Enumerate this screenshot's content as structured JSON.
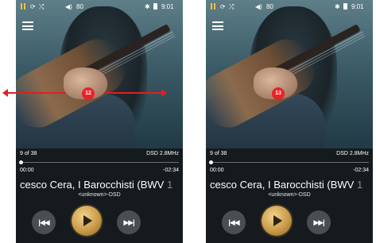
{
  "frames": [
    {
      "statusbar": {
        "volume": "80",
        "time": "9:01"
      },
      "badge": "12",
      "track_position": "9 of 38",
      "format": "DSD 2.8MHz",
      "elapsed": "00:00",
      "remaining": "-02:34",
      "title": "cesco Cera, I Barocchisti (BWV",
      "title_fade": "1",
      "artist_format": "<unknown>-DSD",
      "progress": 0
    },
    {
      "statusbar": {
        "volume": "80",
        "time": "9:01"
      },
      "badge": "13",
      "track_position": "9 of 38",
      "format": "DSD 2.8MHz",
      "elapsed": "00:00",
      "remaining": "-02:34",
      "title": "cesco Cera, I Barocchisti (BWV",
      "title_fade": "1",
      "artist_format": "<unknown>-DSD",
      "progress": 0
    }
  ],
  "icons": [
    "pause-icon",
    "repeat-icon",
    "shuffle-icon",
    "volume-icon",
    "bluetooth-icon",
    "battery-icon",
    "menu-icon",
    "previous-icon",
    "play-icon",
    "next-icon",
    "swipe-arrows",
    "next-step-arrow-icon"
  ],
  "colors": {
    "accent_red": "#e02020",
    "badge_red": "#e8222a",
    "gold": "#c99b4a"
  }
}
